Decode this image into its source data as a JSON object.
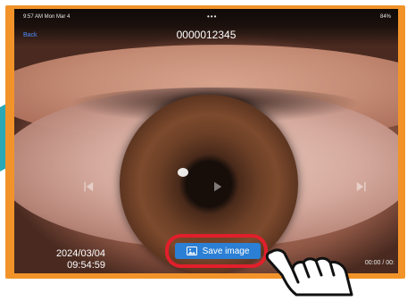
{
  "statusbar": {
    "time": "9:57 AM  Mon Mar 4",
    "dots": "•••",
    "right": "84%"
  },
  "header": {
    "back": "Back",
    "title": "0000012345"
  },
  "overlay": {
    "timestamp_date": "2024/03/04",
    "timestamp_time": "09:54:59",
    "time_right": "00:00 / 00:"
  },
  "actions": {
    "save_label": "Save image"
  },
  "colors": {
    "frame": "#f2932a",
    "button": "#2b7fd4",
    "highlight_ring": "#e11f2b",
    "teal_accent": "#2aa8b6"
  },
  "icons": {
    "prev": "skip-previous-icon",
    "play": "play-icon",
    "next": "skip-next-icon",
    "save": "image-icon",
    "hand": "tap-hand-icon"
  }
}
